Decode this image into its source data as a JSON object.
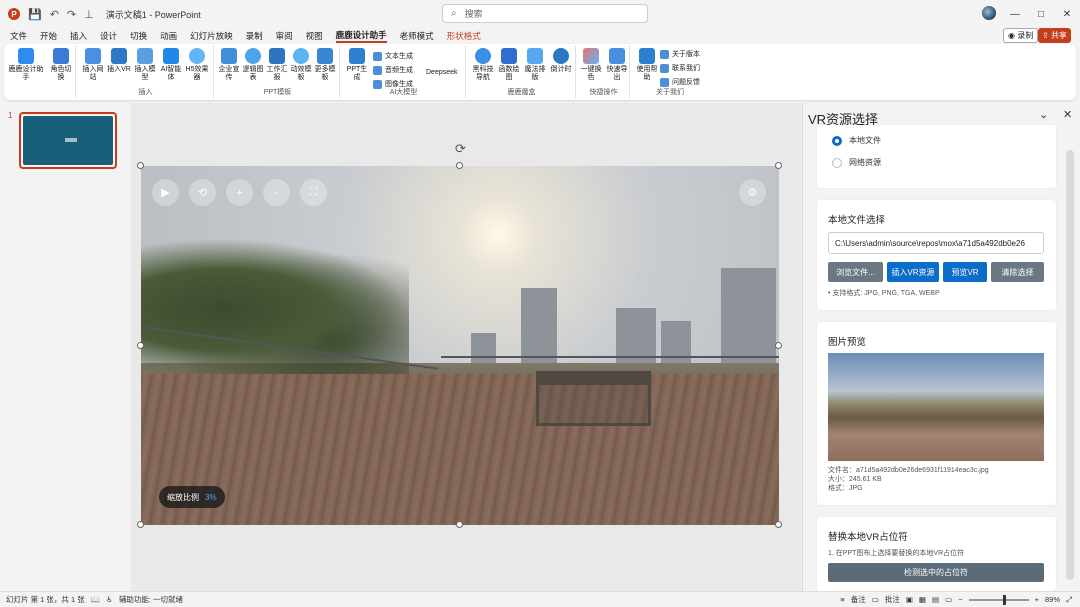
{
  "titlebar": {
    "app_icon": "powerpoint-icon",
    "doc_title": "演示文稿1 - PowerPoint",
    "search_placeholder": "搜索"
  },
  "menu": {
    "tabs": [
      "文件",
      "开始",
      "插入",
      "设计",
      "切换",
      "动画",
      "幻灯片放映",
      "录制",
      "审阅",
      "视图",
      "鹿鹿设计助手",
      "老师模式",
      "形状格式"
    ],
    "active": "鹿鹿设计助手",
    "record_label": "录制",
    "share_label": "共享"
  },
  "ribbon": {
    "groups": [
      {
        "label": "",
        "buttons": [
          "鹿鹿设计助手",
          "角色切换"
        ]
      },
      {
        "label": "插入",
        "buttons": [
          "插入网站",
          "插入VR",
          "插入模型",
          "AI智能体",
          "H5效果器"
        ]
      },
      {
        "label": "PPT模板",
        "buttons": [
          "企业宣传",
          "逻辑图表",
          "工作汇报",
          "动效模板",
          "更多模板"
        ]
      },
      {
        "label": "AI大模型",
        "buttons": [
          "PPT生成",
          "文本生成",
          "音频生成",
          "图像生成",
          "Deepseek"
        ]
      },
      {
        "label": "鹿鹿魔盒",
        "buttons": [
          "黑科技导航",
          "函数绘图",
          "魔法排版",
          "倒计时"
        ]
      },
      {
        "label": "快捷操作",
        "buttons": [
          "一键换色",
          "快速导出"
        ]
      },
      {
        "label": "关于我们",
        "buttons": [
          "使用帮助",
          "关于版本",
          "联系我们",
          "问题反馈"
        ]
      }
    ]
  },
  "thumbnails": {
    "slide_number": "1"
  },
  "slide": {
    "zoom_label": "缩放比例",
    "zoom_value": "3%"
  },
  "panel": {
    "title": "VR资源选择",
    "source": {
      "local": "本地文件",
      "network": "网络资源",
      "selected": "local"
    },
    "local_section": {
      "title": "本地文件选择",
      "path": "C:\\Users\\admin\\source\\repos\\mox\\a71d5a492db0e26",
      "browse": "浏览文件...",
      "insert": "插入VR资源",
      "preview": "预览VR",
      "clear": "清除选择",
      "formats": "• 支持格式: JPG, PNG, TGA, WEBP"
    },
    "preview_section": {
      "title": "图片预览",
      "filename": "文件名：a71d5a492db0e26de6931f11914eac3c.jpg",
      "size": "大小：245.61 KB",
      "format": "格式：JPG"
    },
    "replace_section": {
      "title": "替换本地VR占位符",
      "step1": "1. 在PPT图布上选择要替换的本地VR占位符",
      "detect": "检测选中的占位符"
    }
  },
  "statusbar": {
    "slide_info": "幻灯片 第 1 张，共 1 张",
    "accessibility": "辅助功能: 一切就绪",
    "notes": "备注",
    "comments": "批注",
    "zoom": "89%"
  },
  "colors": {
    "accent": "#c43e1c",
    "primary_button": "#0b6cc9",
    "secondary_button": "#6b7785"
  }
}
